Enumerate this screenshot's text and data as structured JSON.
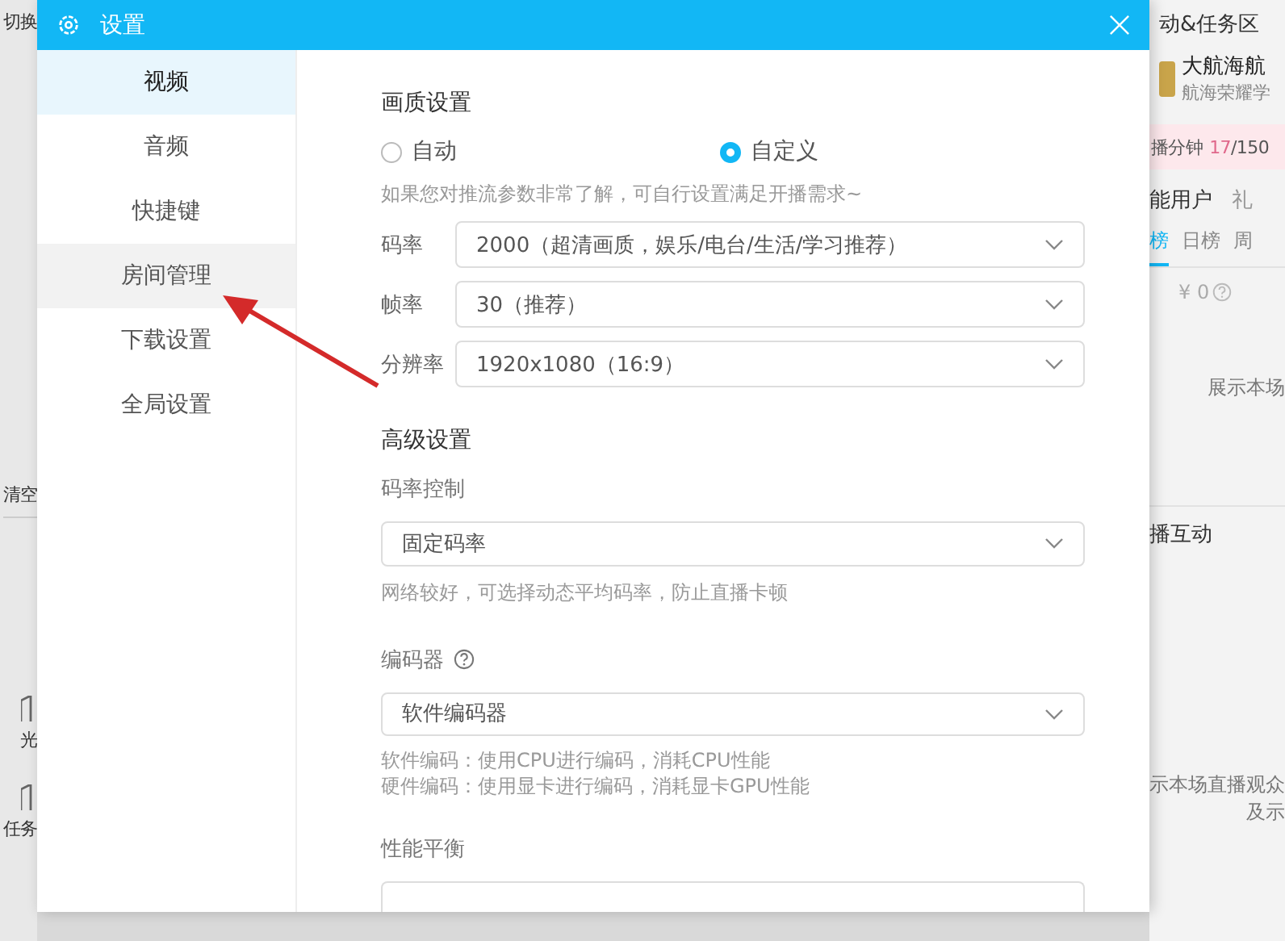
{
  "background_left": {
    "top_label": "切换",
    "clear_label": "清空",
    "nav": [
      {
        "label": "光"
      },
      {
        "label": "任务"
      }
    ]
  },
  "dialog": {
    "title": "设置",
    "nav": [
      {
        "label": "视频",
        "selected": true,
        "hovered": false
      },
      {
        "label": "音频",
        "selected": false,
        "hovered": false
      },
      {
        "label": "快捷键",
        "selected": false,
        "hovered": false
      },
      {
        "label": "房间管理",
        "selected": false,
        "hovered": true
      },
      {
        "label": "下载设置",
        "selected": false,
        "hovered": false
      },
      {
        "label": "全局设置",
        "selected": false,
        "hovered": false
      }
    ],
    "quality": {
      "title": "画质设置",
      "modes": [
        {
          "label": "自动",
          "selected": false
        },
        {
          "label": "自定义",
          "selected": true
        }
      ],
      "hint": "如果您对推流参数非常了解，可自行设置满足开播需求~",
      "rows": [
        {
          "label": "码率",
          "value": "2000（超清画质，娱乐/电台/生活/学习推荐）"
        },
        {
          "label": "帧率",
          "value": "30（推荐）"
        },
        {
          "label": "分辨率",
          "value": "1920x1080（16:9）"
        }
      ]
    },
    "advanced": {
      "title": "高级设置",
      "rate_control": {
        "label": "码率控制",
        "value": "固定码率",
        "hint": "网络较好，可选择动态平均码率，防止直播卡顿"
      },
      "encoder": {
        "label": "编码器",
        "value": "软件编码器",
        "hints": [
          "软件编码：使用CPU进行编码，消耗CPU性能",
          "硬件编码：使用显卡进行编码，消耗显卡GPU性能"
        ]
      },
      "performance": {
        "label": "性能平衡"
      }
    }
  },
  "background_right": {
    "header": "动&任务区",
    "badge": {
      "title": "大航海航",
      "subtitle": "航海荣耀学"
    },
    "progress": {
      "label": "播分钟",
      "count": "17",
      "total": "/150"
    },
    "tabs": [
      {
        "label": "能用户",
        "selected": true
      },
      {
        "label": "礼",
        "selected": false
      }
    ],
    "rank_tabs": [
      {
        "label": "榜",
        "selected": true
      },
      {
        "label": "日榜",
        "selected": false
      },
      {
        "label": "周",
        "selected": false
      }
    ],
    "amount": "¥ 0",
    "empty_text": "展示本场",
    "section_title": "播互动",
    "notes": [
      "示本场直播观众",
      "及示"
    ]
  }
}
